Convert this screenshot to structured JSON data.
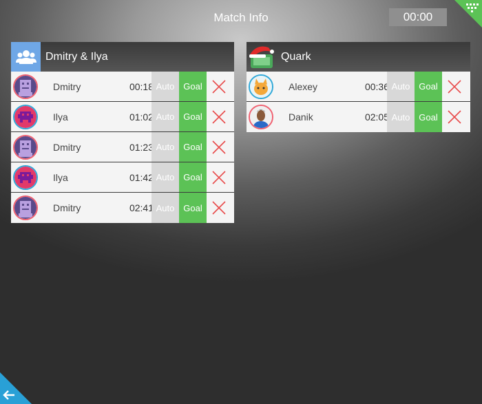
{
  "header": {
    "title": "Match Info",
    "timer": "00:00"
  },
  "teams": [
    {
      "name": "Dmitry & Ilya",
      "logo": "users-icon",
      "goals": [
        {
          "player": "Dmitry",
          "time": "00:18",
          "avatar": "robot-avatar"
        },
        {
          "player": "Ilya",
          "time": "01:02",
          "avatar": "invader-avatar"
        },
        {
          "player": "Dmitry",
          "time": "01:23",
          "avatar": "robot-avatar"
        },
        {
          "player": "Ilya",
          "time": "01:42",
          "avatar": "invader-avatar"
        },
        {
          "player": "Dmitry",
          "time": "02:41",
          "avatar": "robot-avatar"
        }
      ]
    },
    {
      "name": "Quark",
      "logo": "santa-hat-logo",
      "goals": [
        {
          "player": "Alexey",
          "time": "00:36",
          "avatar": "cat-avatar"
        },
        {
          "player": "Danik",
          "time": "02:05",
          "avatar": "person-avatar"
        }
      ]
    }
  ],
  "buttons": {
    "auto": "Auto",
    "goal": "Goal"
  },
  "colors": {
    "goal_green": "#5cc256",
    "auto_gray": "#d8d8d8",
    "delete_red": "#e84a4a",
    "back_blue": "#29a0d6"
  }
}
